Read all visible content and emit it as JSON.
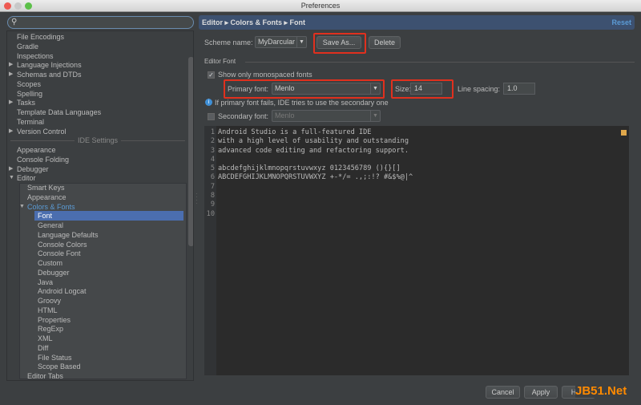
{
  "window": {
    "title": "Preferences"
  },
  "sidebar": {
    "search_placeholder": "",
    "section_label": "IDE Settings",
    "items": [
      {
        "label": "File Encodings",
        "level": 0,
        "arrow": ""
      },
      {
        "label": "Gradle",
        "level": 0,
        "arrow": ""
      },
      {
        "label": "Inspections",
        "level": 0,
        "arrow": ""
      },
      {
        "label": "Language Injections",
        "level": 0,
        "arrow": "▶"
      },
      {
        "label": "Schemas and DTDs",
        "level": 0,
        "arrow": "▶"
      },
      {
        "label": "Scopes",
        "level": 0,
        "arrow": ""
      },
      {
        "label": "Spelling",
        "level": 0,
        "arrow": ""
      },
      {
        "label": "Tasks",
        "level": 0,
        "arrow": "▶"
      },
      {
        "label": "Template Data Languages",
        "level": 0,
        "arrow": ""
      },
      {
        "label": "Terminal",
        "level": 0,
        "arrow": ""
      },
      {
        "label": "Version Control",
        "level": 0,
        "arrow": "▶"
      },
      {
        "label": "",
        "level": -1,
        "arrow": ""
      },
      {
        "label": "Appearance",
        "level": 0,
        "arrow": ""
      },
      {
        "label": "Console Folding",
        "level": 0,
        "arrow": ""
      },
      {
        "label": "Debugger",
        "level": 0,
        "arrow": "▶"
      },
      {
        "label": "Editor",
        "level": 0,
        "arrow": "▼"
      },
      {
        "label": "Smart Keys",
        "level": 1,
        "arrow": ""
      },
      {
        "label": "Appearance",
        "level": 1,
        "arrow": ""
      },
      {
        "label": "Colors & Fonts",
        "level": 1,
        "arrow": "▼",
        "accent": true
      },
      {
        "label": "Font",
        "level": 2,
        "arrow": "",
        "selected": true
      },
      {
        "label": "General",
        "level": 2,
        "arrow": ""
      },
      {
        "label": "Language Defaults",
        "level": 2,
        "arrow": ""
      },
      {
        "label": "Console Colors",
        "level": 2,
        "arrow": ""
      },
      {
        "label": "Console Font",
        "level": 2,
        "arrow": ""
      },
      {
        "label": "Custom",
        "level": 2,
        "arrow": ""
      },
      {
        "label": "Debugger",
        "level": 2,
        "arrow": ""
      },
      {
        "label": "Java",
        "level": 2,
        "arrow": ""
      },
      {
        "label": "Android Logcat",
        "level": 2,
        "arrow": ""
      },
      {
        "label": "Groovy",
        "level": 2,
        "arrow": ""
      },
      {
        "label": "HTML",
        "level": 2,
        "arrow": ""
      },
      {
        "label": "Properties",
        "level": 2,
        "arrow": ""
      },
      {
        "label": "RegExp",
        "level": 2,
        "arrow": ""
      },
      {
        "label": "XML",
        "level": 2,
        "arrow": ""
      },
      {
        "label": "Diff",
        "level": 2,
        "arrow": ""
      },
      {
        "label": "File Status",
        "level": 2,
        "arrow": ""
      },
      {
        "label": "Scope Based",
        "level": 2,
        "arrow": ""
      },
      {
        "label": "Editor Tabs",
        "level": 1,
        "arrow": ""
      }
    ]
  },
  "panel": {
    "breadcrumb": "Editor ▸ Colors & Fonts ▸ Font",
    "reset": "Reset",
    "scheme_label": "Scheme name:",
    "scheme_value": "MyDarcular",
    "save_as": "Save As...",
    "delete": "Delete",
    "editor_font_group": "Editor Font",
    "mono_only": "Show only monospaced fonts",
    "primary_label": "Primary font:",
    "primary_value": "Menlo",
    "size_label": "Size:",
    "size_value": "14",
    "spacing_label": "Line spacing:",
    "spacing_value": "1.0",
    "info": "If primary font fails, IDE tries to use the secondary one",
    "secondary_label": "Secondary font:",
    "secondary_value": "Menlo"
  },
  "preview": {
    "line_numbers": [
      "1",
      "2",
      "3",
      "4",
      "5",
      "6",
      "7",
      "8",
      "9",
      "10"
    ],
    "lines": [
      "Android Studio is a full-featured IDE",
      "with a high level of usability and outstanding",
      "advanced code editing and refactoring support.",
      "",
      "abcdefghijklmnopqrstuvwxyz 0123456789 (){}[]",
      "ABCDEFGHIJKLMNOPQRSTUVWXYZ +-*/= .,;:!? #&$%@|^",
      "",
      "",
      "",
      ""
    ]
  },
  "footer": {
    "cancel": "Cancel",
    "apply": "Apply",
    "help": "Help"
  },
  "watermark": "JB51.Net",
  "colors": {
    "accent": "#4b6eaf",
    "highlight": "#e0301e"
  }
}
